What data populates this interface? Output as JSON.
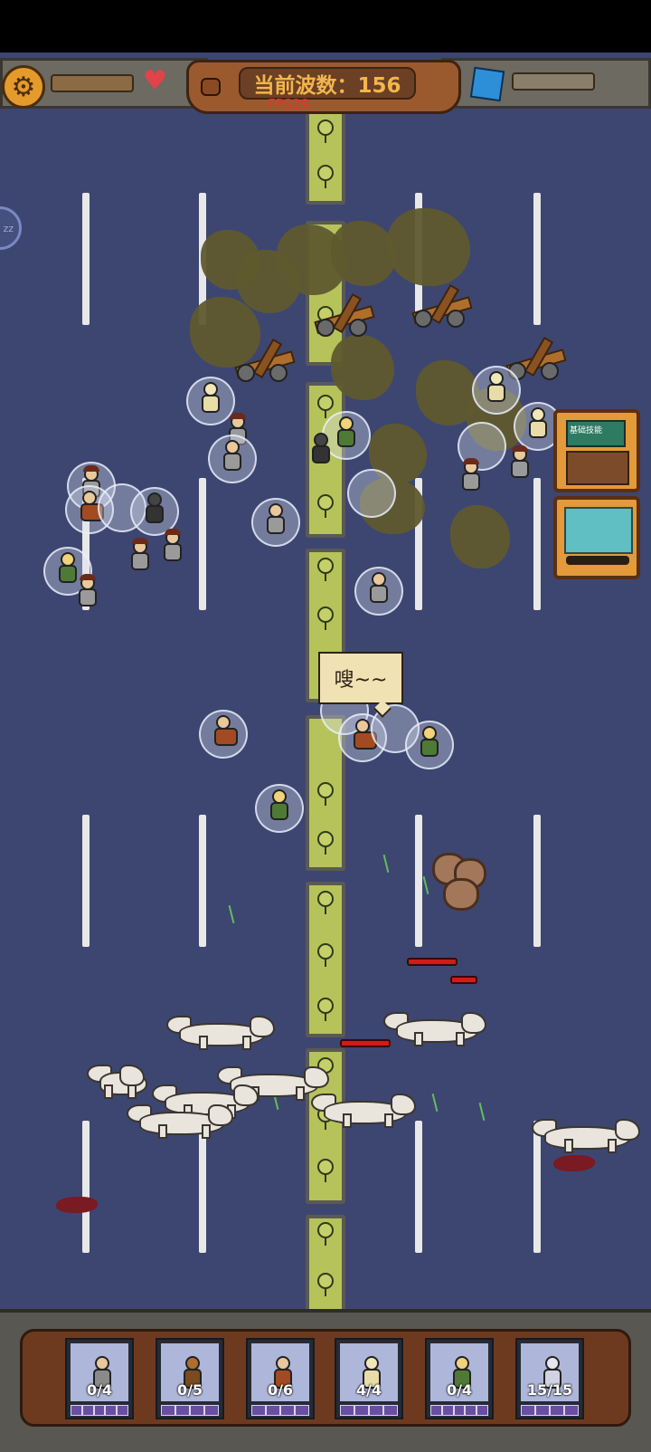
{
  "hud": {
    "wave_label": "当前波数：156",
    "fps_label": "FPS29",
    "settings_icon": "gear-icon",
    "health_icon": "heart-icon",
    "gem_icon": "cube-icon",
    "sleep_label": "zz"
  },
  "speech_bubble": "嗖~~",
  "skill_cards": [
    {
      "icon": "strategy-board-icon",
      "label": "基础技能"
    },
    {
      "icon": "sword-rack-icon",
      "label": ""
    }
  ],
  "unit_slots": [
    {
      "name": "gunner",
      "count": "0/4"
    },
    {
      "name": "catapult",
      "count": "0/5"
    },
    {
      "name": "cavalry",
      "count": "0/6"
    },
    {
      "name": "priest",
      "count": "4/4"
    },
    {
      "name": "elf-archer",
      "count": "0/4"
    },
    {
      "name": "knight",
      "count": "15/15"
    }
  ],
  "colors": {
    "field": "#3d4670",
    "median": "#b6c35b",
    "accent_orange": "#e59a2c",
    "wave_text": "#f2b64c",
    "fps_text": "#e5303a"
  }
}
